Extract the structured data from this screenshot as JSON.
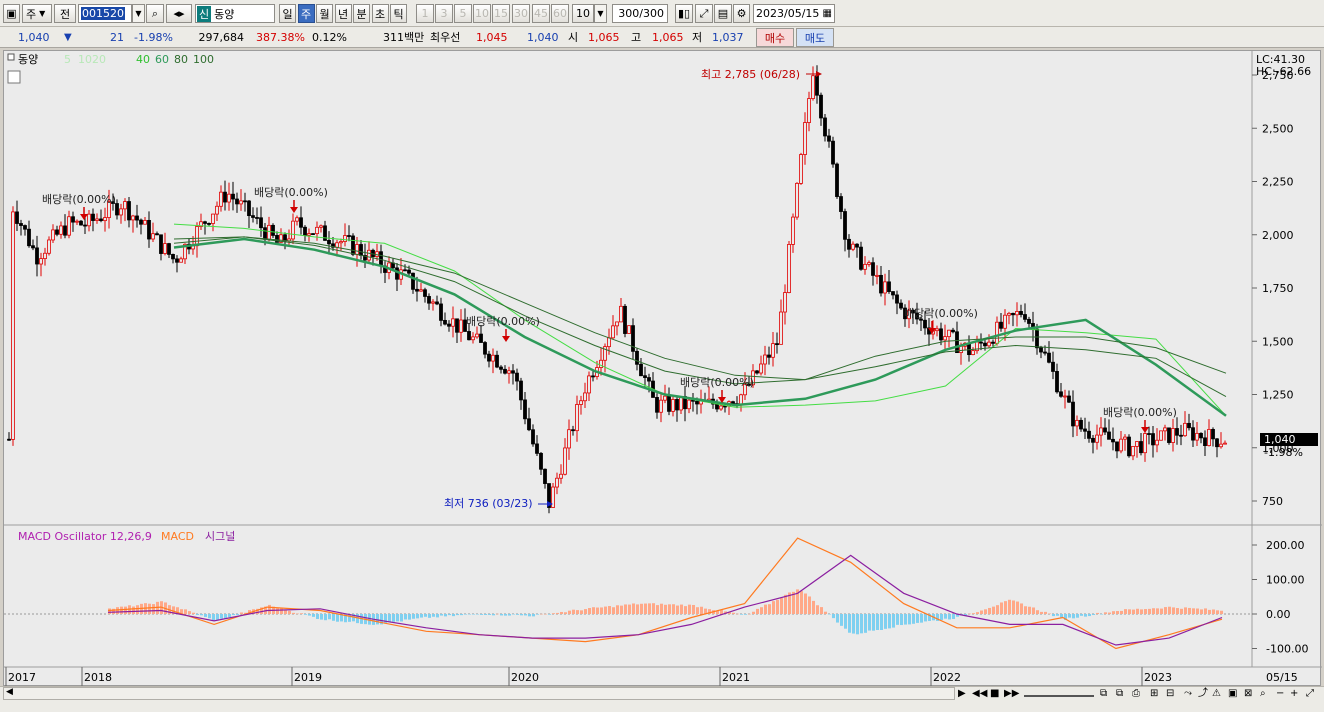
{
  "toolbar": {
    "type_label": "주",
    "jeon_label": "전",
    "code": "001520",
    "new_badge": "신",
    "stock_name": "동양",
    "periods": [
      "일",
      "주",
      "월",
      "년",
      "분",
      "초",
      "틱"
    ],
    "active_period": "주",
    "numbers": [
      "1",
      "3",
      "5",
      "10",
      "15",
      "30",
      "45",
      "60"
    ],
    "count_value": "10",
    "view_count": "300",
    "view_total": "/300",
    "date": "2023/05/15"
  },
  "quote": {
    "price": "1,040",
    "change": "21",
    "change_pct": "-1.98%",
    "volume": "297,684",
    "vol_ratio": "387.38%",
    "turnover": "0.12%",
    "amount": "311백만",
    "best_label": "최우선",
    "best_ask": "1,045",
    "best_bid": "1,040",
    "open_label": "시",
    "open": "1,065",
    "high_label": "고",
    "high": "1,065",
    "low_label": "저",
    "low": "1,037",
    "buy_label": "매수",
    "sell_label": "매도"
  },
  "chart": {
    "legend_name": "동양",
    "ma_periods": [
      "5",
      "10",
      "20",
      "40",
      "60",
      "80",
      "100"
    ],
    "lc_label": "LC:41.30",
    "hc_label": "HC:-62.66",
    "high_marker": "최고 2,785 (06/28)",
    "low_marker": "최저 736 (03/23)",
    "dividend_label": "배당락(0.00%)",
    "current_price_tag": "1,040",
    "current_pct_tag": "-1.98%",
    "y_ticks": [
      "2,750",
      "2,500",
      "2,250",
      "2,000",
      "1,750",
      "1,500",
      "1,250",
      "1,000",
      "750"
    ],
    "macd_title": "MACD Oscillator 12,26,9",
    "macd_label": "MACD",
    "signal_label": "시그널",
    "macd_ticks": [
      "200.00",
      "100.00",
      "0.00",
      "-100.00"
    ],
    "x_ticks": [
      "2017",
      "2018",
      "2019",
      "2020",
      "2021",
      "2022",
      "2023"
    ],
    "x_end_label": "05/15"
  },
  "colors": {
    "up": "#e00000",
    "down": "#000000",
    "ma_light": "#44dd44",
    "ma_mid": "#2e9a5a",
    "ma_dark": "#2f6d2f",
    "macd": "#ff7a20",
    "signal": "#8b1fa0",
    "osc_pos": "#ffa888",
    "osc_neg": "#7fd0f0"
  },
  "chart_data": {
    "type": "candlestick",
    "ylim": [
      650,
      2800
    ],
    "price_points": [
      {
        "x": "2017-01",
        "y": 2150
      },
      {
        "x": "2017-05",
        "y": 1900
      },
      {
        "x": "2017-10",
        "y": 2050
      },
      {
        "x": "2018-01",
        "y": 2050
      },
      {
        "x": "2018-03",
        "y": 2150
      },
      {
        "x": "2018-06",
        "y": 1880
      },
      {
        "x": "2018-09",
        "y": 2200
      },
      {
        "x": "2018-12",
        "y": 1950
      },
      {
        "x": "2019-01",
        "y": 2050
      },
      {
        "x": "2019-04",
        "y": 1950
      },
      {
        "x": "2019-07",
        "y": 1800
      },
      {
        "x": "2019-10",
        "y": 1560
      },
      {
        "x": "2020-01",
        "y": 1350
      },
      {
        "x": "2020-03",
        "y": 736
      },
      {
        "x": "2020-05",
        "y": 1280
      },
      {
        "x": "2020-07",
        "y": 1650
      },
      {
        "x": "2020-09",
        "y": 1200
      },
      {
        "x": "2020-12",
        "y": 1200
      },
      {
        "x": "2021-02",
        "y": 1250
      },
      {
        "x": "2021-04",
        "y": 1500
      },
      {
        "x": "2021-06",
        "y": 2785
      },
      {
        "x": "2021-08",
        "y": 1950
      },
      {
        "x": "2021-11",
        "y": 1650
      },
      {
        "x": "2022-01",
        "y": 1550
      },
      {
        "x": "2022-03",
        "y": 1450
      },
      {
        "x": "2022-06",
        "y": 1650
      },
      {
        "x": "2022-09",
        "y": 1100
      },
      {
        "x": "2022-12",
        "y": 1000
      },
      {
        "x": "2023-03",
        "y": 1080
      },
      {
        "x": "2023-05",
        "y": 1040
      }
    ],
    "series": [
      {
        "name": "20",
        "values": [
          2050,
          2030,
          1990,
          1960,
          1830,
          1600,
          1400,
          1250,
          1190,
          1200,
          1220,
          1290,
          1560,
          1540,
          1510,
          1150
        ]
      },
      {
        "name": "40",
        "values": [
          1940,
          1980,
          1930,
          1850,
          1720,
          1520,
          1360,
          1250,
          1200,
          1230,
          1320,
          1460,
          1550,
          1600,
          1390,
          1150
        ]
      },
      {
        "name": "60",
        "values": [
          1960,
          1990,
          1950,
          1880,
          1780,
          1620,
          1480,
          1360,
          1300,
          1320,
          1430,
          1500,
          1520,
          1520,
          1470,
          1350
        ]
      },
      {
        "name": "80",
        "values": [
          1980,
          1990,
          1960,
          1900,
          1820,
          1680,
          1540,
          1420,
          1340,
          1320,
          1380,
          1450,
          1480,
          1460,
          1420,
          1240
        ]
      }
    ],
    "macd": [
      10,
      20,
      -30,
      20,
      10,
      -20,
      -50,
      -60,
      -70,
      -80,
      -60,
      -10,
      30,
      220,
      150,
      30,
      -40,
      -40,
      -10,
      -100,
      -60,
      -15
    ],
    "signal": [
      5,
      10,
      -20,
      10,
      15,
      -15,
      -40,
      -60,
      -70,
      -70,
      -60,
      -30,
      20,
      60,
      170,
      60,
      0,
      -30,
      -30,
      -90,
      -70,
      -10
    ],
    "oscillator": [
      15,
      35,
      -20,
      25,
      -15,
      -30,
      -10,
      0,
      -5,
      15,
      30,
      25,
      -5,
      75,
      -60,
      -30,
      -10,
      40,
      -15,
      10,
      20,
      10
    ]
  }
}
